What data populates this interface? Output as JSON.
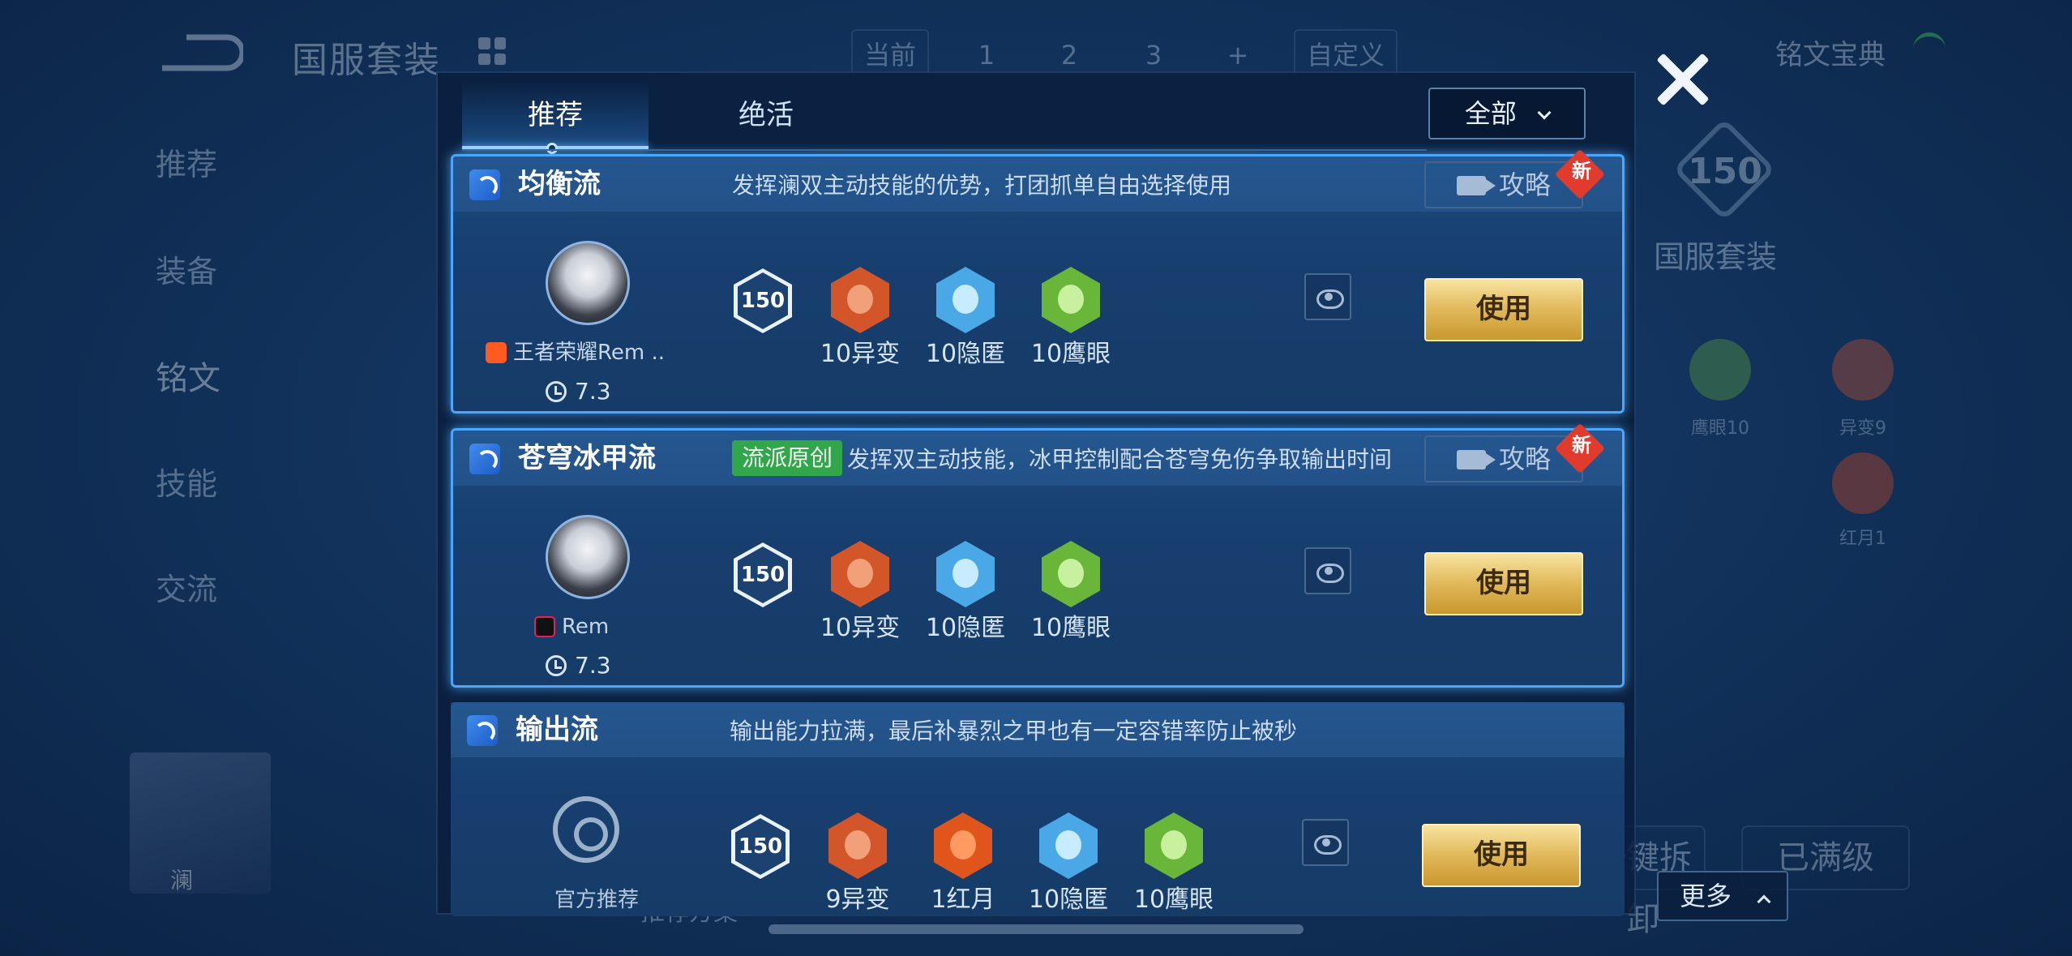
{
  "background": {
    "title": "国服套装",
    "page_tabs": [
      "当前",
      "1",
      "2",
      "3",
      "+",
      "自定义"
    ],
    "rune_book": "铭文宝典",
    "sidebar": [
      "推荐",
      "装备",
      "铭文",
      "技能",
      "交流"
    ],
    "right_panel": {
      "level": "150",
      "title": "国服套装",
      "runes": [
        {
          "label": "鹰眼10"
        },
        {
          "label": "异变9"
        },
        {
          "label": "红月1"
        }
      ]
    },
    "hero_name": "澜",
    "bottom_buttons": [
      "一键拆卸",
      "已满级"
    ],
    "bottom_tab": "推荐方案"
  },
  "modal": {
    "tabs": [
      "推荐",
      "绝活"
    ],
    "filter_label": "全部",
    "cards": [
      {
        "name": "均衡流",
        "tag": "",
        "desc": "发挥澜双主动技能的优势，打团抓单自由选择使用",
        "guide_label": "攻略",
        "badge": "新",
        "author": "王者荣耀Rem ..",
        "platform": "kuaishou",
        "version": "7.3",
        "level": "150",
        "runes": [
          {
            "label": "10异变",
            "color": "#d2562a"
          },
          {
            "label": "10隐匿",
            "color": "#4aa8e6"
          },
          {
            "label": "10鹰眼",
            "color": "#6ab63a"
          }
        ],
        "use_label": "使用",
        "selected": true
      },
      {
        "name": "苍穹冰甲流",
        "tag": "流派原创",
        "desc": "发挥双主动技能，冰甲控制配合苍穹免伤争取输出时间",
        "guide_label": "攻略",
        "badge": "新",
        "author": "Rem",
        "platform": "douyin",
        "version": "7.3",
        "level": "150",
        "runes": [
          {
            "label": "10异变",
            "color": "#d2562a"
          },
          {
            "label": "10隐匿",
            "color": "#4aa8e6"
          },
          {
            "label": "10鹰眼",
            "color": "#6ab63a"
          }
        ],
        "use_label": "使用",
        "selected": true
      },
      {
        "name": "输出流",
        "tag": "",
        "desc": "输出能力拉满，最后补暴烈之甲也有一定容错率防止被秒",
        "official_label": "官方推荐",
        "level": "150",
        "runes": [
          {
            "label": "9异变",
            "color": "#d2562a"
          },
          {
            "label": "1红月",
            "color": "#e0551c"
          },
          {
            "label": "10隐匿",
            "color": "#4aa8e6"
          },
          {
            "label": "10鹰眼",
            "color": "#6ab63a"
          }
        ],
        "use_label": "使用",
        "selected": false
      }
    ],
    "more_label": "更多"
  }
}
